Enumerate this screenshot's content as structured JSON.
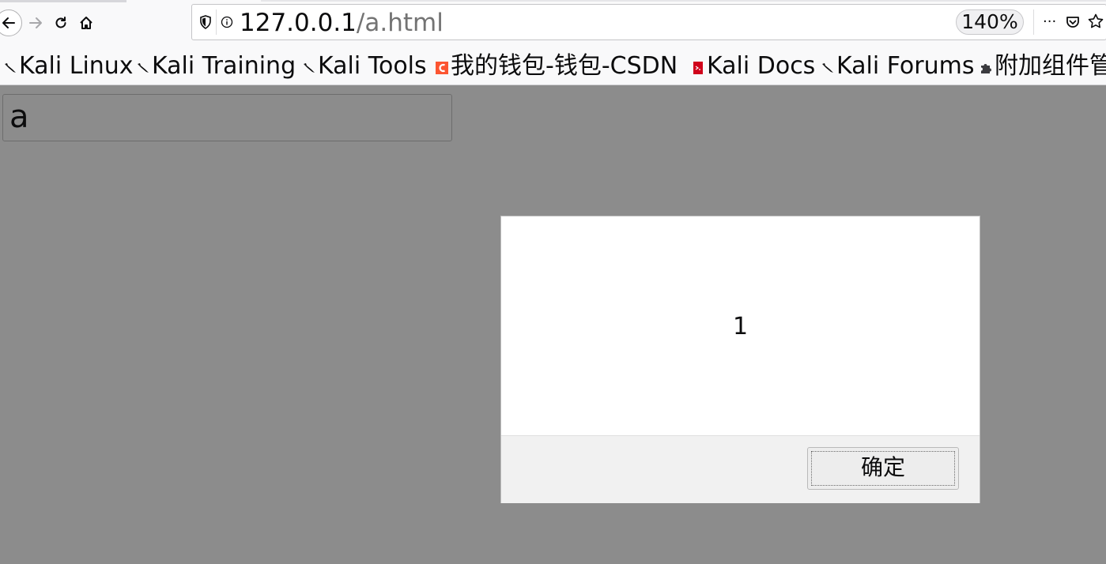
{
  "toolbar": {
    "url_host": "127.0.0.1",
    "url_path": "/a.html",
    "zoom": "140%",
    "more_label": "···"
  },
  "bookmarks": [
    {
      "label": "Kali Linux",
      "icon": "kali-dragon-icon"
    },
    {
      "label": "Kali Training",
      "icon": "kali-dragon-icon"
    },
    {
      "label": "Kali Tools",
      "icon": "kali-dragon-icon"
    },
    {
      "label": "我的钱包-钱包-CSDN",
      "icon": "csdn-icon"
    },
    {
      "label": "Kali Docs",
      "icon": "kali-docs-icon"
    },
    {
      "label": "Kali Forums",
      "icon": "kali-dragon-icon"
    },
    {
      "label": "附加组件管",
      "icon": "puzzle-icon"
    }
  ],
  "page": {
    "input_value": "a"
  },
  "alert": {
    "message": "1",
    "ok_label": "确定"
  },
  "colors": {
    "overlay": "#8c8c8c",
    "csdn": "#fc5531",
    "kali_docs": "#d0021b"
  }
}
